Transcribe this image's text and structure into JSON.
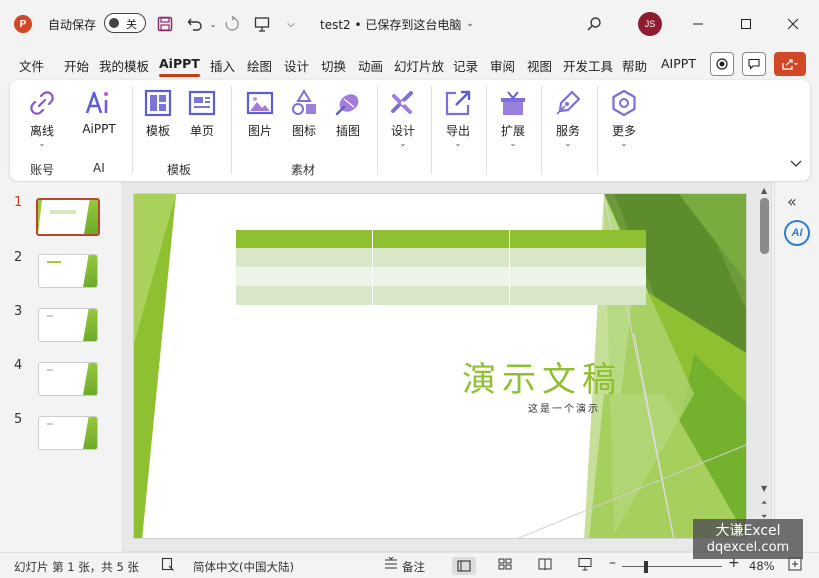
{
  "titlebar": {
    "app_logo": "P",
    "autosave_label": "自动保存",
    "autosave_state": "关",
    "doc_title": "test2 • 已保存到这台电脑",
    "avatar_initials": "JS",
    "icons": [
      "save-icon",
      "undo-icon",
      "redo-icon",
      "present-icon",
      "customize-icon",
      "search-icon"
    ]
  },
  "tabs": {
    "items": [
      "文件",
      "开始",
      "我的模板",
      "AiPPT",
      "插入",
      "绘图",
      "设计",
      "切换",
      "动画",
      "幻灯片放",
      "记录",
      "审阅",
      "视图",
      "开发工具",
      "帮助",
      "AIPPT"
    ],
    "active": "AiPPT"
  },
  "ribbon": {
    "buttons": [
      {
        "label": "离线",
        "icon": "link-icon",
        "caret": true
      },
      {
        "label": "AiPPT",
        "icon": "ai-icon",
        "caret": false
      },
      {
        "label": "模板",
        "icon": "template-icon",
        "caret": false
      },
      {
        "label": "单页",
        "icon": "single-page-icon",
        "caret": false
      },
      {
        "label": "图片",
        "icon": "image-icon",
        "caret": false
      },
      {
        "label": "图标",
        "icon": "shapes-icon",
        "caret": false
      },
      {
        "label": "插图",
        "icon": "illustration-icon",
        "caret": false
      },
      {
        "label": "设计",
        "icon": "design-icon",
        "caret": true
      },
      {
        "label": "导出",
        "icon": "export-icon",
        "caret": true
      },
      {
        "label": "扩展",
        "icon": "extension-icon",
        "caret": true
      },
      {
        "label": "服务",
        "icon": "pen-icon",
        "caret": true
      },
      {
        "label": "更多",
        "icon": "more-icon",
        "caret": true
      }
    ],
    "groups": [
      "账号",
      "AI",
      "模板",
      "素材"
    ]
  },
  "thumbnails": [
    "1",
    "2",
    "3",
    "4",
    "5"
  ],
  "slide": {
    "title": "演示文稿",
    "subtitle": "这是一个演示"
  },
  "statusbar": {
    "slide_info": "幻灯片 第 1 张，共 5 张",
    "language": "简体中文(中国大陆)",
    "notes": "备注",
    "zoom": "48%"
  },
  "watermark": {
    "line1": "大谦Excel",
    "line2": "dqexcel.com"
  },
  "colors": {
    "accent": "#c43e1c",
    "slide_green": "#8fc031",
    "ribbon_purple": "#8a56c9"
  }
}
